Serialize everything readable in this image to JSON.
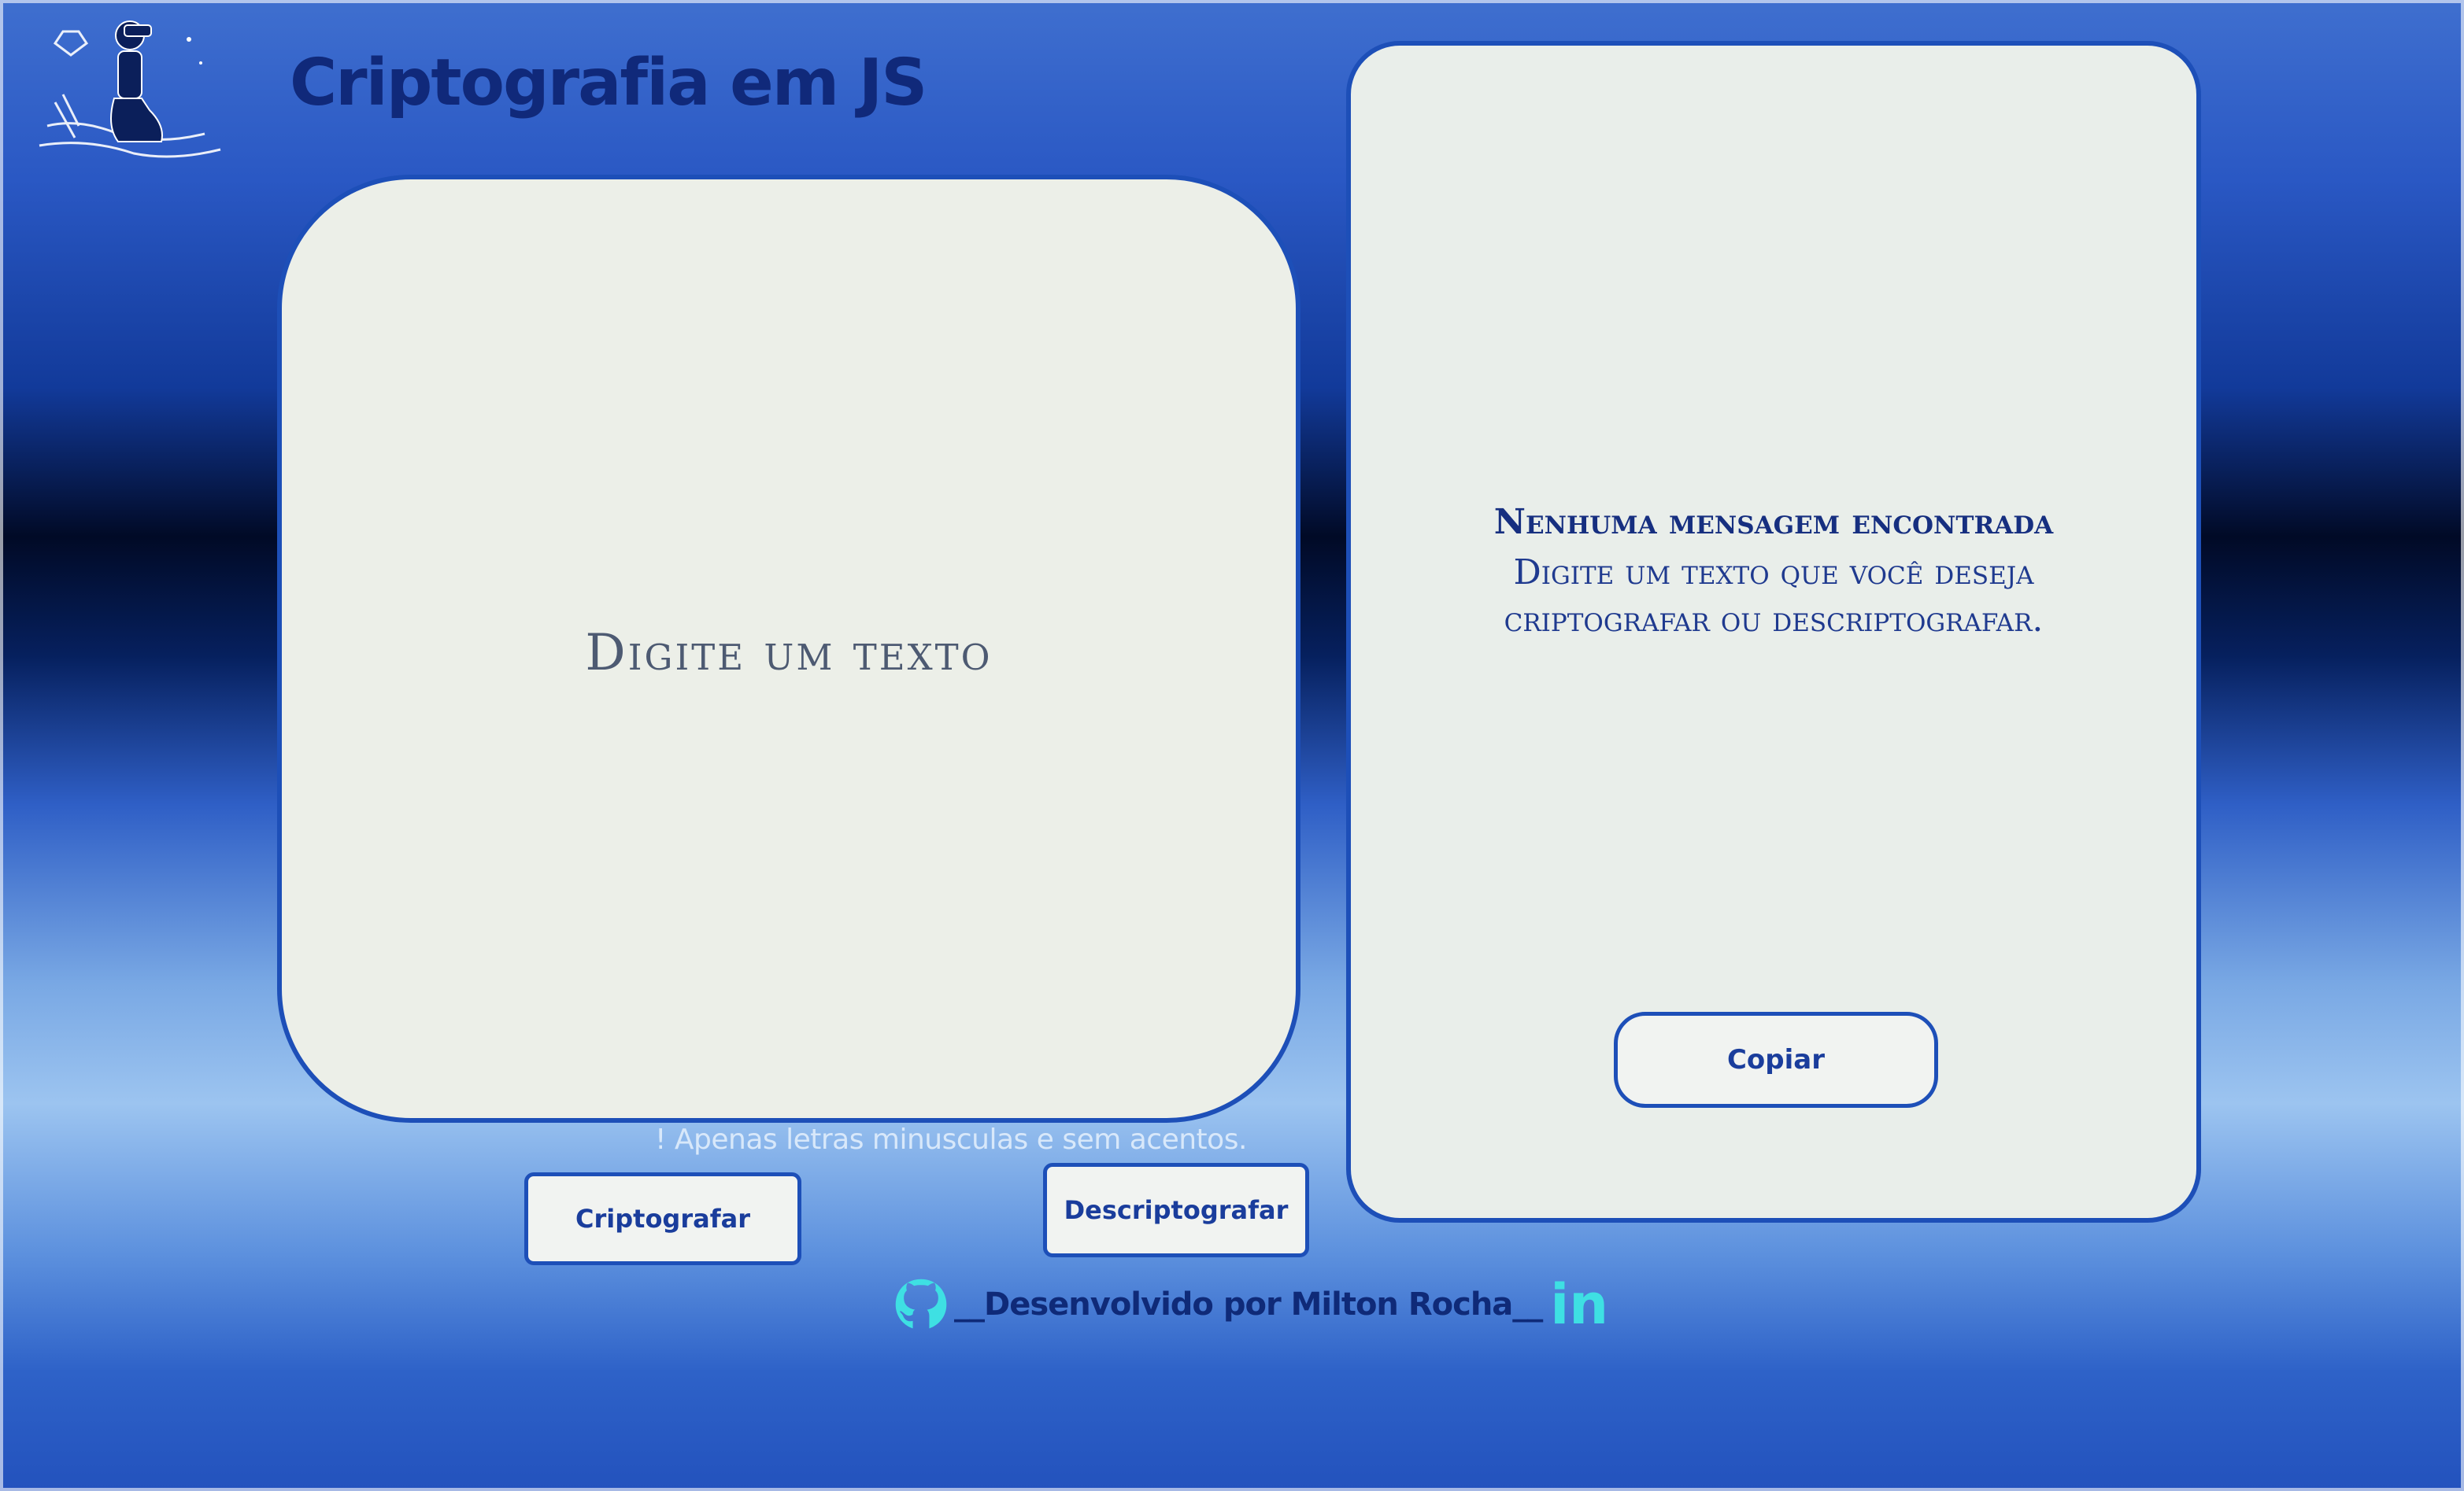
{
  "header": {
    "logo_icon": "person-with-binoculars-illustration",
    "title": "Criptografia em JS"
  },
  "input_panel": {
    "placeholder": "Digite um texto",
    "warning": "! Apenas letras minusculas e sem acentos."
  },
  "actions": {
    "encrypt_label": "Criptografar",
    "decrypt_label": "Descriptografar"
  },
  "output_panel": {
    "heading": "Nenhuma mensagem encontrada",
    "message": "Digite um texto que você deseja criptografar ou descriptografar.",
    "copy_label": "Copiar"
  },
  "footer": {
    "github_icon": "github-icon",
    "text": "__Desenvolvido por Milton Rocha__",
    "linkedin_label": "in",
    "linkedin_icon": "linkedin-icon"
  },
  "colors": {
    "accent": "#1d4fb8",
    "title": "#10297a",
    "icon_cyan": "#3ee0e3"
  }
}
